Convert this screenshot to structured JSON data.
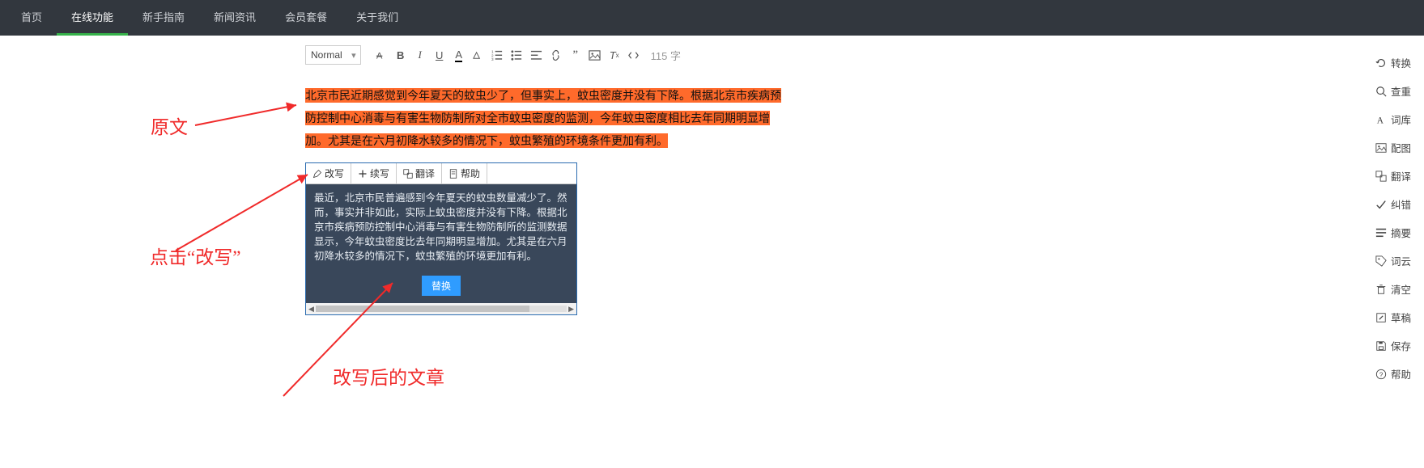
{
  "nav": {
    "items": [
      "首页",
      "在线功能",
      "新手指南",
      "新闻资讯",
      "会员套餐",
      "关于我们"
    ],
    "activeIndex": 1
  },
  "toolbar": {
    "format": "Normal",
    "word_count": "115 字"
  },
  "editor": {
    "highlighted_text": "北京市民近期感觉到今年夏天的蚊虫少了，但事实上，蚊虫密度并没有下降。根据北京市疾病预防控制中心消毒与有害生物防制所对全市蚊虫密度的监测，今年蚊虫密度相比去年同期明显增加。尤其是在六月初降水较多的情况下，蚊虫繁殖的环境条件更加有利。"
  },
  "popup": {
    "actions": [
      "改写",
      "续写",
      "翻译",
      "帮助"
    ],
    "rewritten_text": "最近，北京市民普遍感到今年夏天的蚊虫数量减少了。然而，事实并非如此，实际上蚊虫密度并没有下降。根据北京市疾病预防控制中心消毒与有害生物防制所的监测数据显示，今年蚊虫密度比去年同期明显增加。尤其是在六月初降水较多的情况下，蚊虫繁殖的环境更加有利。",
    "replace_label": "替换"
  },
  "sidebar": {
    "items": [
      "转换",
      "查重",
      "词库",
      "配图",
      "翻译",
      "纠错",
      "摘要",
      "词云",
      "清空",
      "草稿",
      "保存",
      "帮助"
    ]
  },
  "annotations": {
    "a1": "原文",
    "a2": "点击“改写”",
    "a3": "改写后的文章"
  }
}
